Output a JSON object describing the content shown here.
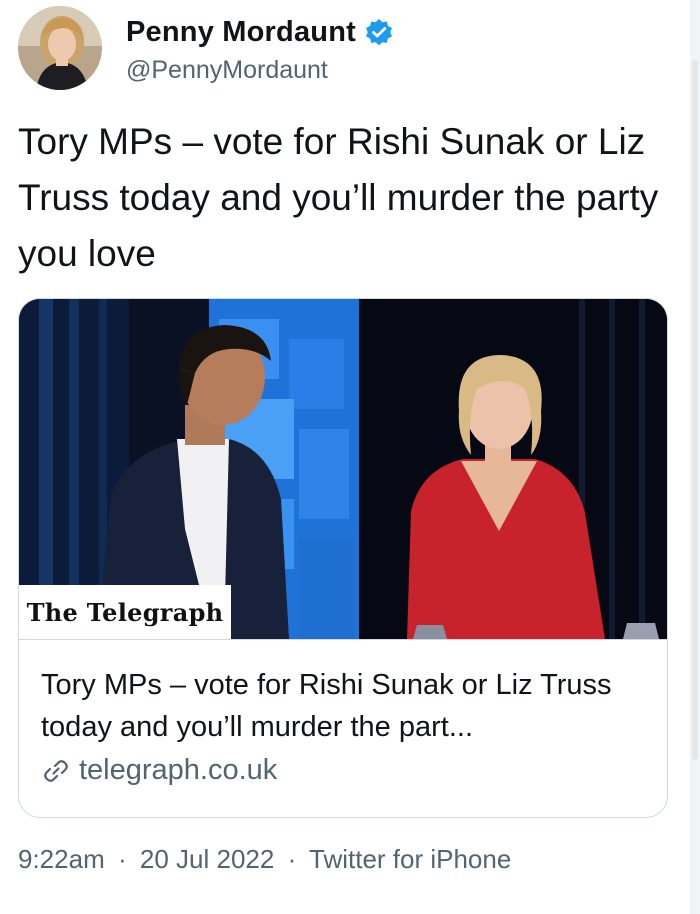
{
  "author": {
    "display_name": "Penny Mordaunt",
    "handle": "@PennyMordaunt",
    "verified_icon": "verified-badge-icon",
    "avatar_icon": "profile-photo"
  },
  "tweet": {
    "text": "Tory MPs – vote for Rishi Sunak or Liz Truss today and you’ll murder the party you love"
  },
  "card": {
    "image_brand_label": "The Telegraph",
    "title": "Tory MPs – vote for Rishi Sunak or Liz Truss today and you’ll murder the part...",
    "domain": "telegraph.co.uk",
    "link_icon": "link-icon"
  },
  "meta": {
    "time": "9:22am",
    "date": "20 Jul 2022",
    "source": "Twitter for iPhone",
    "separator": "·"
  },
  "colors": {
    "verified_blue": "#1d9bf0",
    "secondary_text": "#536471",
    "primary_text": "#0f1419",
    "card_border": "#cfd9de",
    "dress_red": "#c8232c",
    "stage_blue": "#1f73d8"
  }
}
